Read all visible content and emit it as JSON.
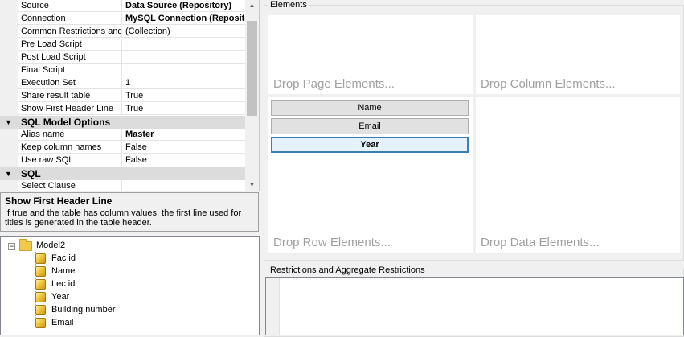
{
  "properties": {
    "rows": [
      {
        "name": "Source",
        "value": "Data Source (Repository)",
        "bold": true
      },
      {
        "name": "Connection",
        "value": "MySQL Connection (Repository)",
        "bold": true
      },
      {
        "name": "Common Restrictions and Values",
        "value": "(Collection)",
        "bold": false
      },
      {
        "name": "Pre Load Script",
        "value": "",
        "bold": false
      },
      {
        "name": "Post Load Script",
        "value": "",
        "bold": false
      },
      {
        "name": "Final Script",
        "value": "",
        "bold": false
      },
      {
        "name": "Execution Set",
        "value": "1",
        "bold": false
      },
      {
        "name": "Share result table",
        "value": "True",
        "bold": false
      },
      {
        "name": "Show First Header Line",
        "value": "True",
        "bold": false
      }
    ],
    "category_sql_model": "SQL Model Options",
    "sql_model_rows": [
      {
        "name": "Alias name",
        "value": "Master",
        "bold": true
      },
      {
        "name": "Keep column names",
        "value": "False",
        "bold": false
      },
      {
        "name": "Use raw SQL",
        "value": "False",
        "bold": false
      }
    ],
    "category_sql": "SQL",
    "sql_rows": [
      {
        "name": "Select Clause",
        "value": ""
      }
    ]
  },
  "description": {
    "title": "Show First Header Line",
    "text": "If true and the table has column values, the first line used for titles is generated in the table header."
  },
  "tree": {
    "root": "Model2",
    "children": [
      "Fac id",
      "Name",
      "Lec id",
      "Year",
      "Building number",
      "Email"
    ]
  },
  "elements": {
    "title": "Elements",
    "drop_page": "Drop Page Elements...",
    "drop_column": "Drop Column Elements...",
    "drop_row": "Drop Row Elements...",
    "drop_data": "Drop Data Elements...",
    "row_fields": [
      "Name",
      "Email",
      "Year"
    ],
    "selected_field": "Year"
  },
  "restrictions": {
    "title": "Restrictions and Aggregate Restrictions"
  }
}
